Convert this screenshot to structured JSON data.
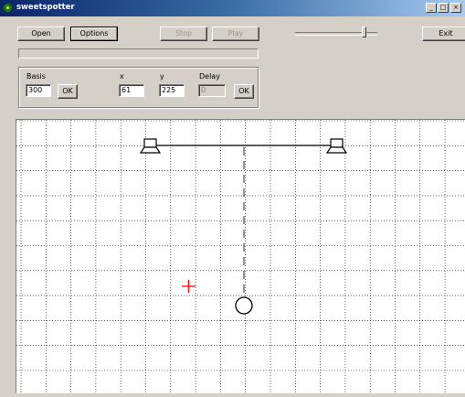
{
  "window": {
    "title": "sweetspotter"
  },
  "toolbar": {
    "open_label": "Open",
    "options_label": "Options",
    "stop_label": "Stop",
    "play_label": "Play",
    "exit_label": "Exit"
  },
  "controls": {
    "basis_label": "Basis",
    "basis_value": "300",
    "basis_ok_label": "OK",
    "x_label": "x",
    "x_value": "61",
    "y_label": "y",
    "y_value": "225",
    "delay_label": "Delay",
    "delay_value": "0",
    "delay_ok_label": "OK"
  },
  "colors": {
    "marker": "#ff0000",
    "titlebar_start": "#0a246a"
  }
}
